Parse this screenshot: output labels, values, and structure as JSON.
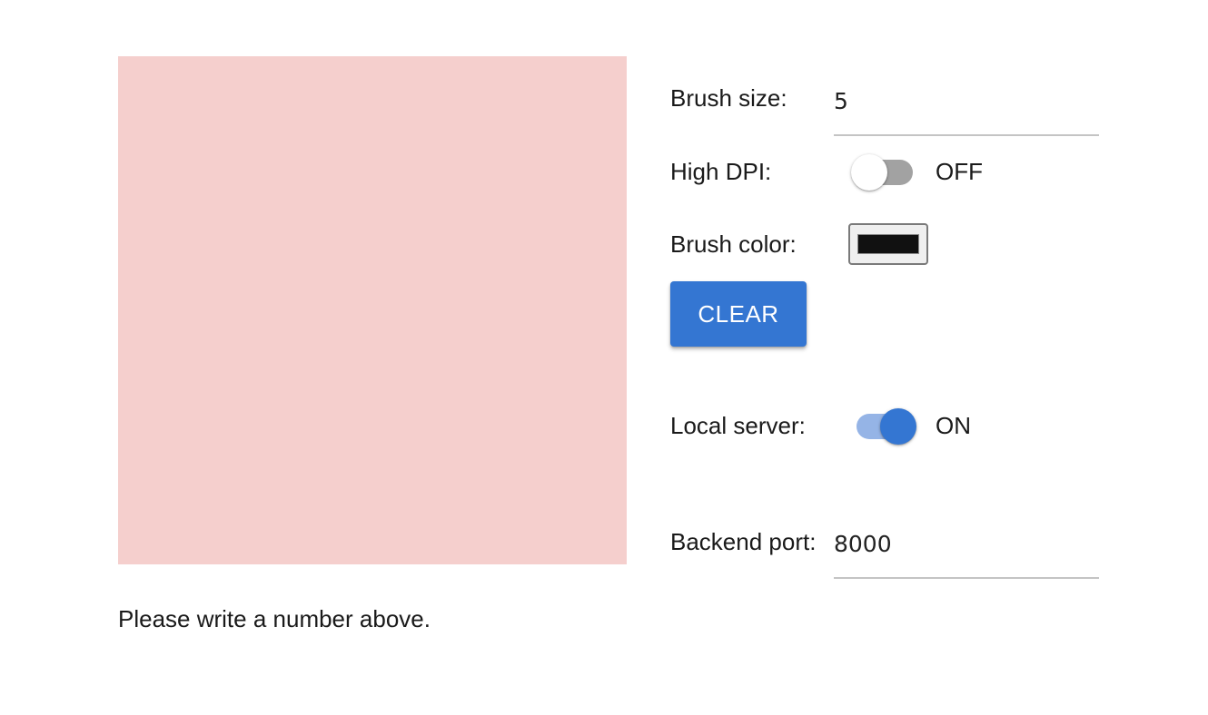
{
  "canvas": {
    "background": "#f5cfcd"
  },
  "hint_text": "Please write a number above.",
  "controls": {
    "brush_size": {
      "label": "Brush size:",
      "value": "5"
    },
    "high_dpi": {
      "label": "High DPI:",
      "state": "OFF",
      "on": false
    },
    "brush_color": {
      "label": "Brush color:",
      "value": "#111111"
    },
    "clear_button": {
      "label": "CLEAR",
      "color": "#3476d2"
    },
    "local_server": {
      "label": "Local server:",
      "state": "ON",
      "on": true
    },
    "backend_port": {
      "label": "Backend port:",
      "value": "8000"
    }
  },
  "colors": {
    "accent": "#3476d2",
    "accent_light": "#95b4e6",
    "switch_off_track": "#a2a2a2"
  }
}
